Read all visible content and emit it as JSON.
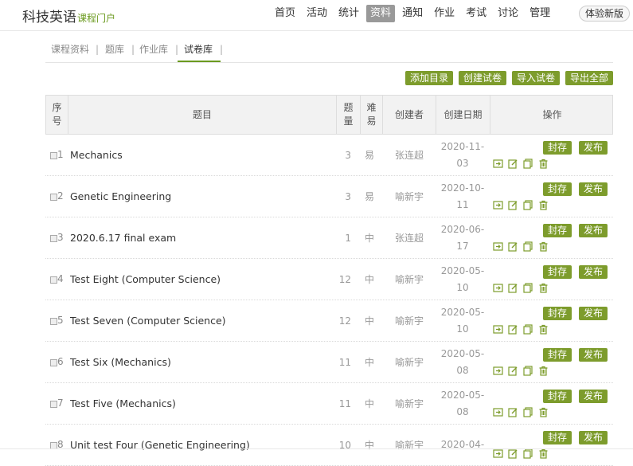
{
  "brand": {
    "title": "科技英语",
    "subtitle": "课程门户"
  },
  "nav": [
    "首页",
    "活动",
    "统计",
    "资料",
    "通知",
    "作业",
    "考试",
    "讨论",
    "管理"
  ],
  "nav_active_index": 3,
  "beta_label": "体验新版",
  "subtabs": [
    "课程资料",
    "题库",
    "作业库",
    "试卷库"
  ],
  "subtab_active_index": 3,
  "actions": [
    "添加目录",
    "创建试卷",
    "导入试卷",
    "导出全部"
  ],
  "columns": [
    "序\n号",
    "题目",
    "题\n量",
    "难\n易",
    "创建者",
    "创建日期",
    "操作"
  ],
  "row_actions": {
    "seal": "封存",
    "publish": "发布"
  },
  "rows": [
    {
      "idx": "1",
      "title": "Mechanics",
      "count": "3",
      "diff": "易",
      "creator": "张连超",
      "date": "2020-11-\n03"
    },
    {
      "idx": "2",
      "title": "Genetic Engineering",
      "count": "3",
      "diff": "易",
      "creator": "喻新宇",
      "date": "2020-10-\n11"
    },
    {
      "idx": "3",
      "title": "2020.6.17 final exam",
      "count": "1",
      "diff": "中",
      "creator": "张连超",
      "date": "2020-06-\n17"
    },
    {
      "idx": "4",
      "title": "Test Eight (Computer Science)",
      "count": "12",
      "diff": "中",
      "creator": "喻新宇",
      "date": "2020-05-\n10"
    },
    {
      "idx": "5",
      "title": "Test Seven (Computer Science)",
      "count": "12",
      "diff": "中",
      "creator": "喻新宇",
      "date": "2020-05-\n10"
    },
    {
      "idx": "6",
      "title": "Test Six (Mechanics)",
      "count": "11",
      "diff": "中",
      "creator": "喻新宇",
      "date": "2020-05-\n08"
    },
    {
      "idx": "7",
      "title": "Test Five (Mechanics)",
      "count": "11",
      "diff": "中",
      "creator": "喻新宇",
      "date": "2020-05-\n08"
    },
    {
      "idx": "8",
      "title": "Unit test Four (Genetic Engineering)",
      "count": "10",
      "diff": "中",
      "creator": "喻新宇",
      "date": "2020-04-\n"
    }
  ],
  "colors": {
    "accent": "#7d9c2c",
    "brand_sub": "#6b9a1f"
  }
}
